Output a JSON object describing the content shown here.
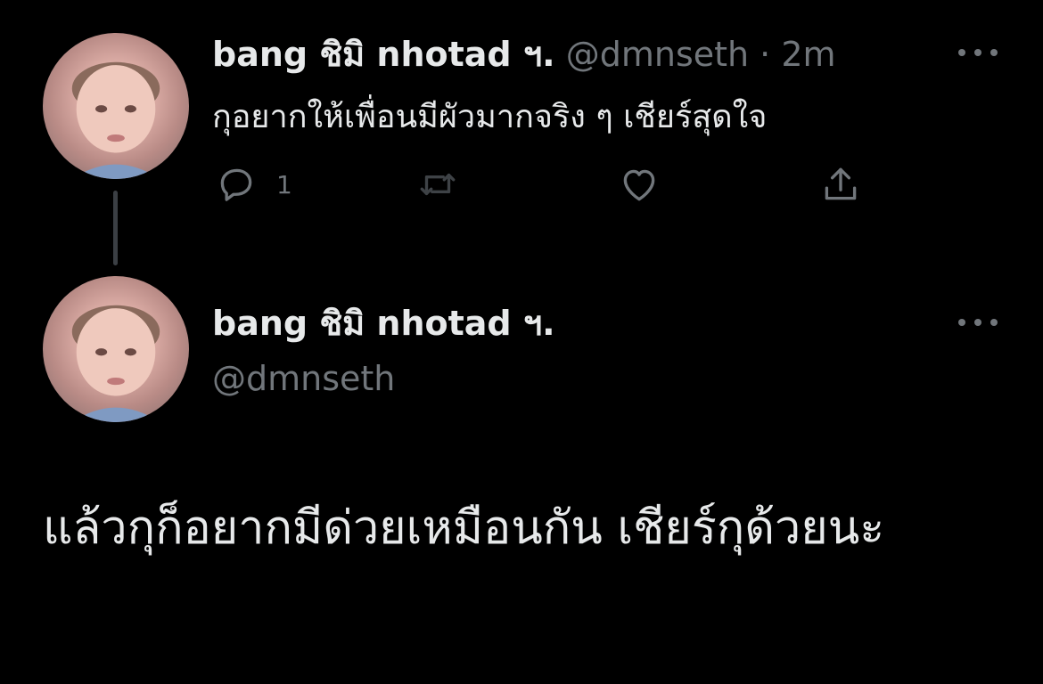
{
  "parent_tweet": {
    "display_name": "bang ชิมิ nhotad ฯ.",
    "meta": "@dmnseth · 2m",
    "text": "กุอยากให้เพื่อนมีผัวมากจริง ๆ เชียร์สุดใจ",
    "reply_count": "1",
    "icons": [
      "reply-icon",
      "retweet-icon",
      "like-icon",
      "share-icon",
      "more-icon"
    ]
  },
  "main_tweet": {
    "display_name": "bang ชิมิ nhotad ฯ.",
    "handle": "@dmnseth",
    "text": "แล้วกุก็อยากมีด่วยเหมือนกัน เชียร์กุด้วยนะ",
    "icons": [
      "more-icon"
    ]
  },
  "colors": {
    "background": "#000000",
    "primary_text": "#e7e9ea",
    "secondary_text": "#71767b",
    "thread_line": "#3b3f44"
  }
}
